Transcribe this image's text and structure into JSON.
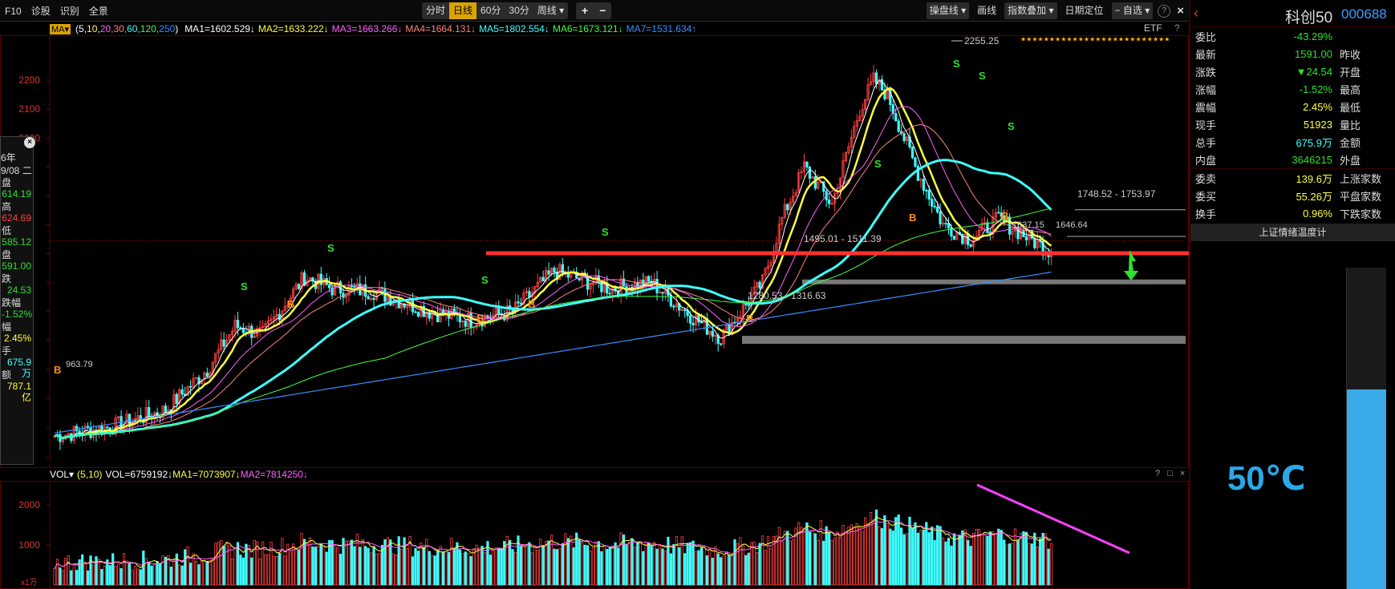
{
  "toolbar": {
    "left_items": [
      "F10",
      "诊股",
      "识别",
      "全景"
    ],
    "periods": [
      {
        "label": "分时",
        "active": false
      },
      {
        "label": "日线",
        "active": true
      },
      {
        "label": "60分",
        "active": false
      },
      {
        "label": "30分",
        "active": false
      },
      {
        "label": "周线 ▾",
        "active": false
      }
    ],
    "zoom": [
      "+",
      "−"
    ],
    "right_items": [
      "操盘线 ▾",
      "画线",
      "指数叠加 ▾",
      "日期定位",
      "− 自选 ▾"
    ],
    "help": "?",
    "close": "×"
  },
  "ma_legend": {
    "dropdown": "MA▾",
    "params_open": "(5,",
    "params": [
      {
        "text": "10,",
        "color": "#ffff40"
      },
      {
        "text": "20,",
        "color": "#ff60ff"
      },
      {
        "text": "30,",
        "color": "#ff8080"
      },
      {
        "text": "60,",
        "color": "#40ffff"
      },
      {
        "text": "120,",
        "color": "#40ff40"
      },
      {
        "text": "250",
        "color": "#3a8cff"
      }
    ],
    "params_close": ")",
    "items": [
      {
        "text": "MA1=1602.529↓",
        "color": "#ffffff"
      },
      {
        "text": "MA2=1633.222↓",
        "color": "#ffff40"
      },
      {
        "text": "MA3=1663.266↓",
        "color": "#ff60ff"
      },
      {
        "text": "MA4=1664.131↓",
        "color": "#ff8080"
      },
      {
        "text": "MA5=1802.554↓",
        "color": "#40ffff"
      },
      {
        "text": "MA6=1673.121↓",
        "color": "#40ff40"
      },
      {
        "text": "MA7=1531.634↑",
        "color": "#3a8cff"
      }
    ],
    "etf": "ETF",
    "help": "?"
  },
  "y_axis": {
    "labels": [
      2200,
      2100,
      2000
    ],
    "partial_labels": [
      "0",
      "0",
      "0",
      "0",
      "0",
      "0",
      "0",
      "0",
      "0",
      "0",
      "0",
      "0",
      "0"
    ]
  },
  "annotations": {
    "high": "2255.25",
    "low": "963.79",
    "zone1": "1748.52 - 1753.97",
    "zone2": "1495.01 - 1511.39",
    "zone3": "1280.53 - 1316.63",
    "zone4": "1637.15",
    "zone5": "1646.64",
    "signal_buy": "B",
    "signal_sell": "S",
    "stars": "★★★★★★★★★★★★★★★★★★★★★★★★★★"
  },
  "info_overlay": {
    "close_icon": "×",
    "year": "6年",
    "date": "9/08 二",
    "rows": [
      {
        "label": "盘",
        "value": "614.19",
        "color": "#2ee02e"
      },
      {
        "label": "高",
        "value": "624.69",
        "color": "#ff4040"
      },
      {
        "label": "低",
        "value": "585.12",
        "color": "#2ee02e"
      },
      {
        "label": "盘",
        "value": "591.00",
        "color": "#2ee02e"
      },
      {
        "label": "跌",
        "value": "24.53",
        "color": "#2ee02e"
      },
      {
        "label": "跌幅",
        "value": "-1.52%",
        "color": "#2ee02e"
      },
      {
        "label": "幅",
        "value": "2.45%",
        "color": "#ffff40"
      },
      {
        "label": "手",
        "value": "675.9万",
        "color": "#40ffff"
      },
      {
        "label": "额",
        "value": "787.1亿",
        "color": "#ffff40"
      }
    ]
  },
  "volume": {
    "legend_dropdown": "VOL▾",
    "legend_params": "(5,10)",
    "legend_value": "VOL=6759192↓",
    "ma1": "MA1=7073907↓",
    "ma2": "MA2=7814250↓",
    "y_labels": [
      "2000",
      "1000"
    ],
    "unit": "x1万",
    "controls": "? □ ×"
  },
  "right_panel": {
    "back": "‹",
    "name": "科创50",
    "code": "000688",
    "rows": [
      {
        "label": "委比",
        "value": "-43.29%",
        "color": "#2ee02e",
        "label2": ""
      },
      {
        "label": "最新",
        "value": "1591.00",
        "color": "#2ee02e",
        "label2": "昨收"
      },
      {
        "label": "涨跌",
        "value": "▼24.54",
        "color": "#2ee02e",
        "label2": "开盘"
      },
      {
        "label": "涨幅",
        "value": "-1.52%",
        "color": "#2ee02e",
        "label2": "最高"
      },
      {
        "label": "震幅",
        "value": "2.45%",
        "color": "#ffff40",
        "label2": "最低"
      },
      {
        "label": "现手",
        "value": "51923",
        "color": "#ffff40",
        "label2": "量比"
      },
      {
        "label": "总手",
        "value": "675.9万",
        "color": "#40ffff",
        "label2": "金额"
      },
      {
        "label": "内盘",
        "value": "3646215",
        "color": "#2ee02e",
        "label2": "外盘"
      }
    ],
    "rows2": [
      {
        "label": "委卖",
        "value": "139.6万",
        "color": "#ffff40",
        "label2": "上涨家数"
      },
      {
        "label": "委买",
        "value": "55.26万",
        "color": "#ffff40",
        "label2": "平盘家数"
      },
      {
        "label": "换手",
        "value": "0.96%",
        "color": "#ffff40",
        "label2": "下跌家数"
      }
    ],
    "temp_button": "上证情绪温度计",
    "temperature": "50℃",
    "gauge_level": 0.62
  },
  "colors": {
    "up": "#ff4040",
    "down": "#40ffff",
    "ma5": "#ffffff",
    "ma10": "#ffff40",
    "ma20": "#ff60ff",
    "ma30": "#ff8080",
    "ma60": "#40ffff",
    "ma120": "#40ff40",
    "ma250": "#3a8cff",
    "support": "#ff3030",
    "vol_trend": "#ff40ff"
  }
}
